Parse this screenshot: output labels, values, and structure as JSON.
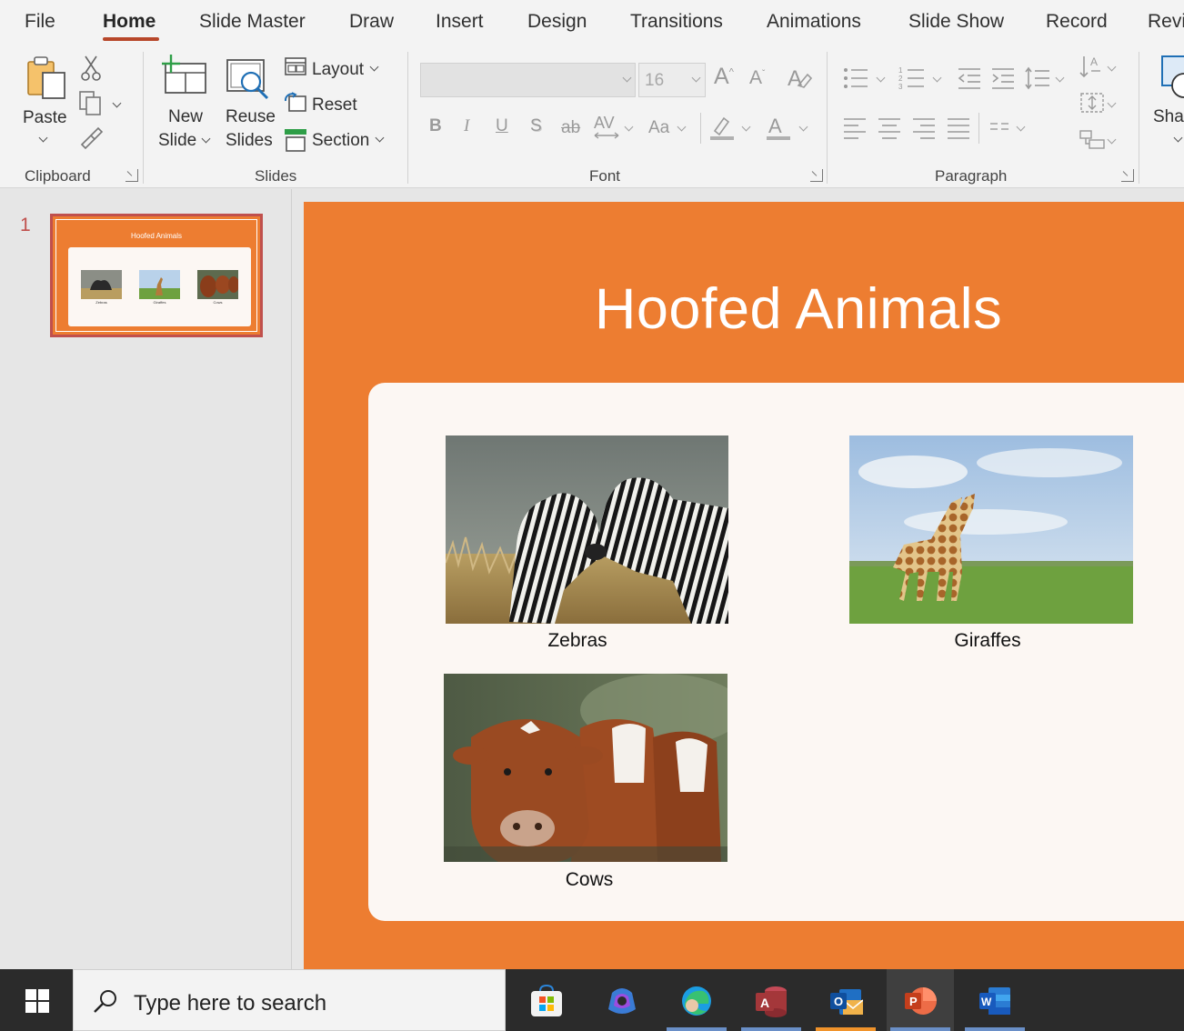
{
  "tabs": [
    "File",
    "Home",
    "Slide Master",
    "Draw",
    "Insert",
    "Design",
    "Transitions",
    "Animations",
    "Slide Show",
    "Record",
    "Revi"
  ],
  "active_tab": "Home",
  "ribbon": {
    "clipboard": {
      "label": "Clipboard",
      "paste": "Paste"
    },
    "slides": {
      "label": "Slides",
      "new": "New",
      "slide": "Slide",
      "reuse": "Reuse",
      "slides_word": "Slides",
      "layout": "Layout",
      "reset": "Reset",
      "section": "Section"
    },
    "font": {
      "label": "Font",
      "size": "16",
      "case": "Aa"
    },
    "paragraph": {
      "label": "Paragraph"
    },
    "sha": "Sha"
  },
  "thumbnail": {
    "number": "1",
    "title": "Hoofed Animals",
    "captions": [
      "Zebras",
      "Giraffes",
      "Cows"
    ]
  },
  "slide": {
    "title": "Hoofed Animals",
    "captions": {
      "zebras": "Zebras",
      "giraffes": "Giraffes",
      "cows": "Cows"
    }
  },
  "taskbar": {
    "search_placeholder": "Type here to search"
  },
  "colors": {
    "slide_bg": "#ed7d31",
    "card_bg": "#fcf7f3",
    "accent": "#b7472a"
  }
}
